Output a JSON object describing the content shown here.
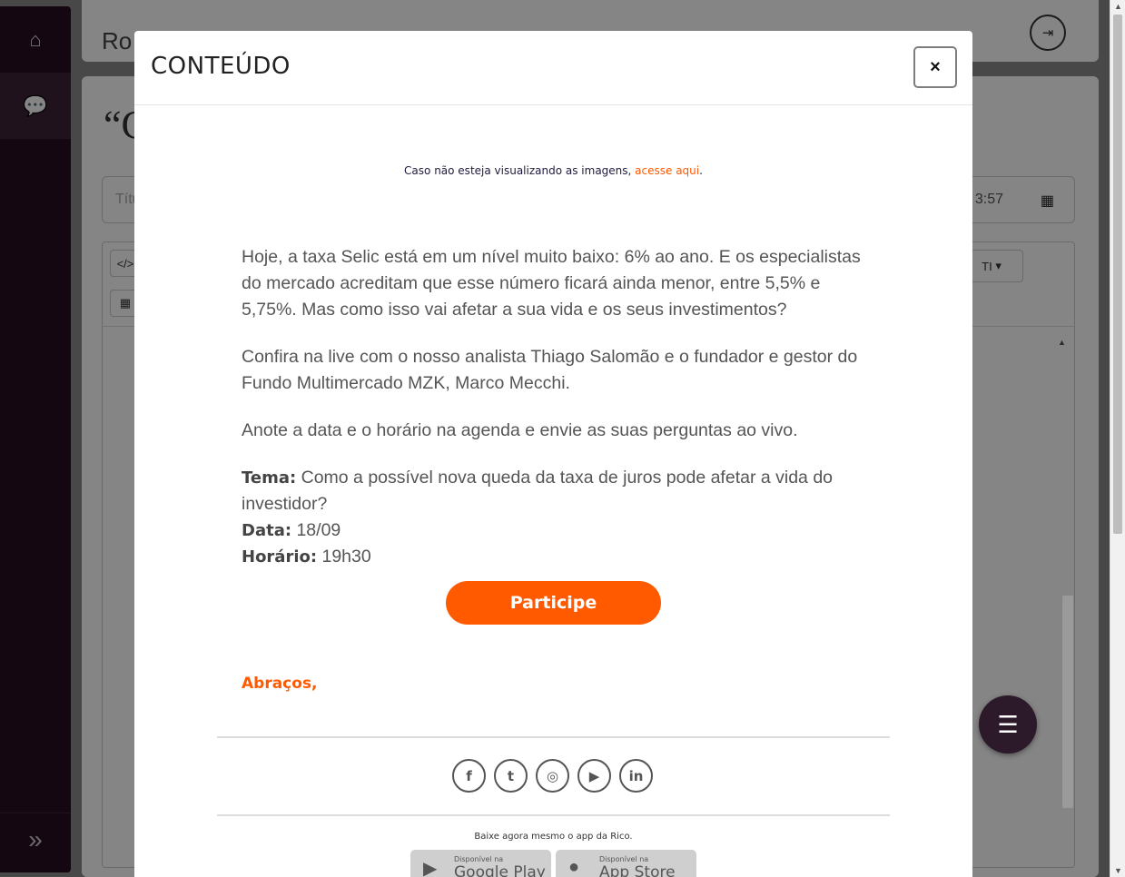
{
  "app": {
    "logo_text": "Ro",
    "title_placeholder": "Títu",
    "date_fragment": "3:57",
    "editor_code_label": "</>",
    "editor_font_label": "TI",
    "quote_mark": "“C"
  },
  "sidebar": {
    "items": [
      {
        "icon": "home-icon"
      },
      {
        "icon": "comments-icon"
      }
    ],
    "expand_icon": "double-chevron-right-icon"
  },
  "modal": {
    "title": "CONTEÚDO",
    "close_label": "×",
    "notice_prefix": "Caso não esteja visualizando as imagens, ",
    "notice_link": "acesse aqui",
    "notice_suffix": ".",
    "paragraphs": [
      "Hoje, a taxa Selic está em um nível muito baixo: 6% ao ano. E os especialistas do mercado acreditam que esse número ficará ainda menor, entre 5,5% e 5,75%. Mas como isso vai afetar a sua vida e os seus investimentos?",
      "Confira na live com o nosso analista Thiago Salomão e o fundador e gestor do Fundo Multimercado MZK, Marco Mecchi.",
      "Anote a data e o horário na agenda e envie as suas perguntas ao vivo."
    ],
    "info": {
      "tema_label": "Tema:",
      "tema_value": " Como a possível nova queda da taxa de juros pode afetar a vida do investidor?",
      "data_label": "Data:",
      "data_value": " 18/09",
      "horario_label": "Horário:",
      "horario_value": " 19h30"
    },
    "cta_label": "Participe",
    "closing": "Abraços,",
    "social": [
      "facebook-icon",
      "twitter-icon",
      "instagram-icon",
      "youtube-icon",
      "linkedin-icon"
    ],
    "app_cta": "Baixe agora mesmo o app da Rico.",
    "stores": [
      {
        "small": "Disponível na",
        "big": "Google Play"
      },
      {
        "small": "Disponível na",
        "big": "App Store"
      }
    ]
  },
  "colors": {
    "accent": "#ff5a00",
    "sidebar": "#2a0f24",
    "fab": "#2c1a2a"
  }
}
